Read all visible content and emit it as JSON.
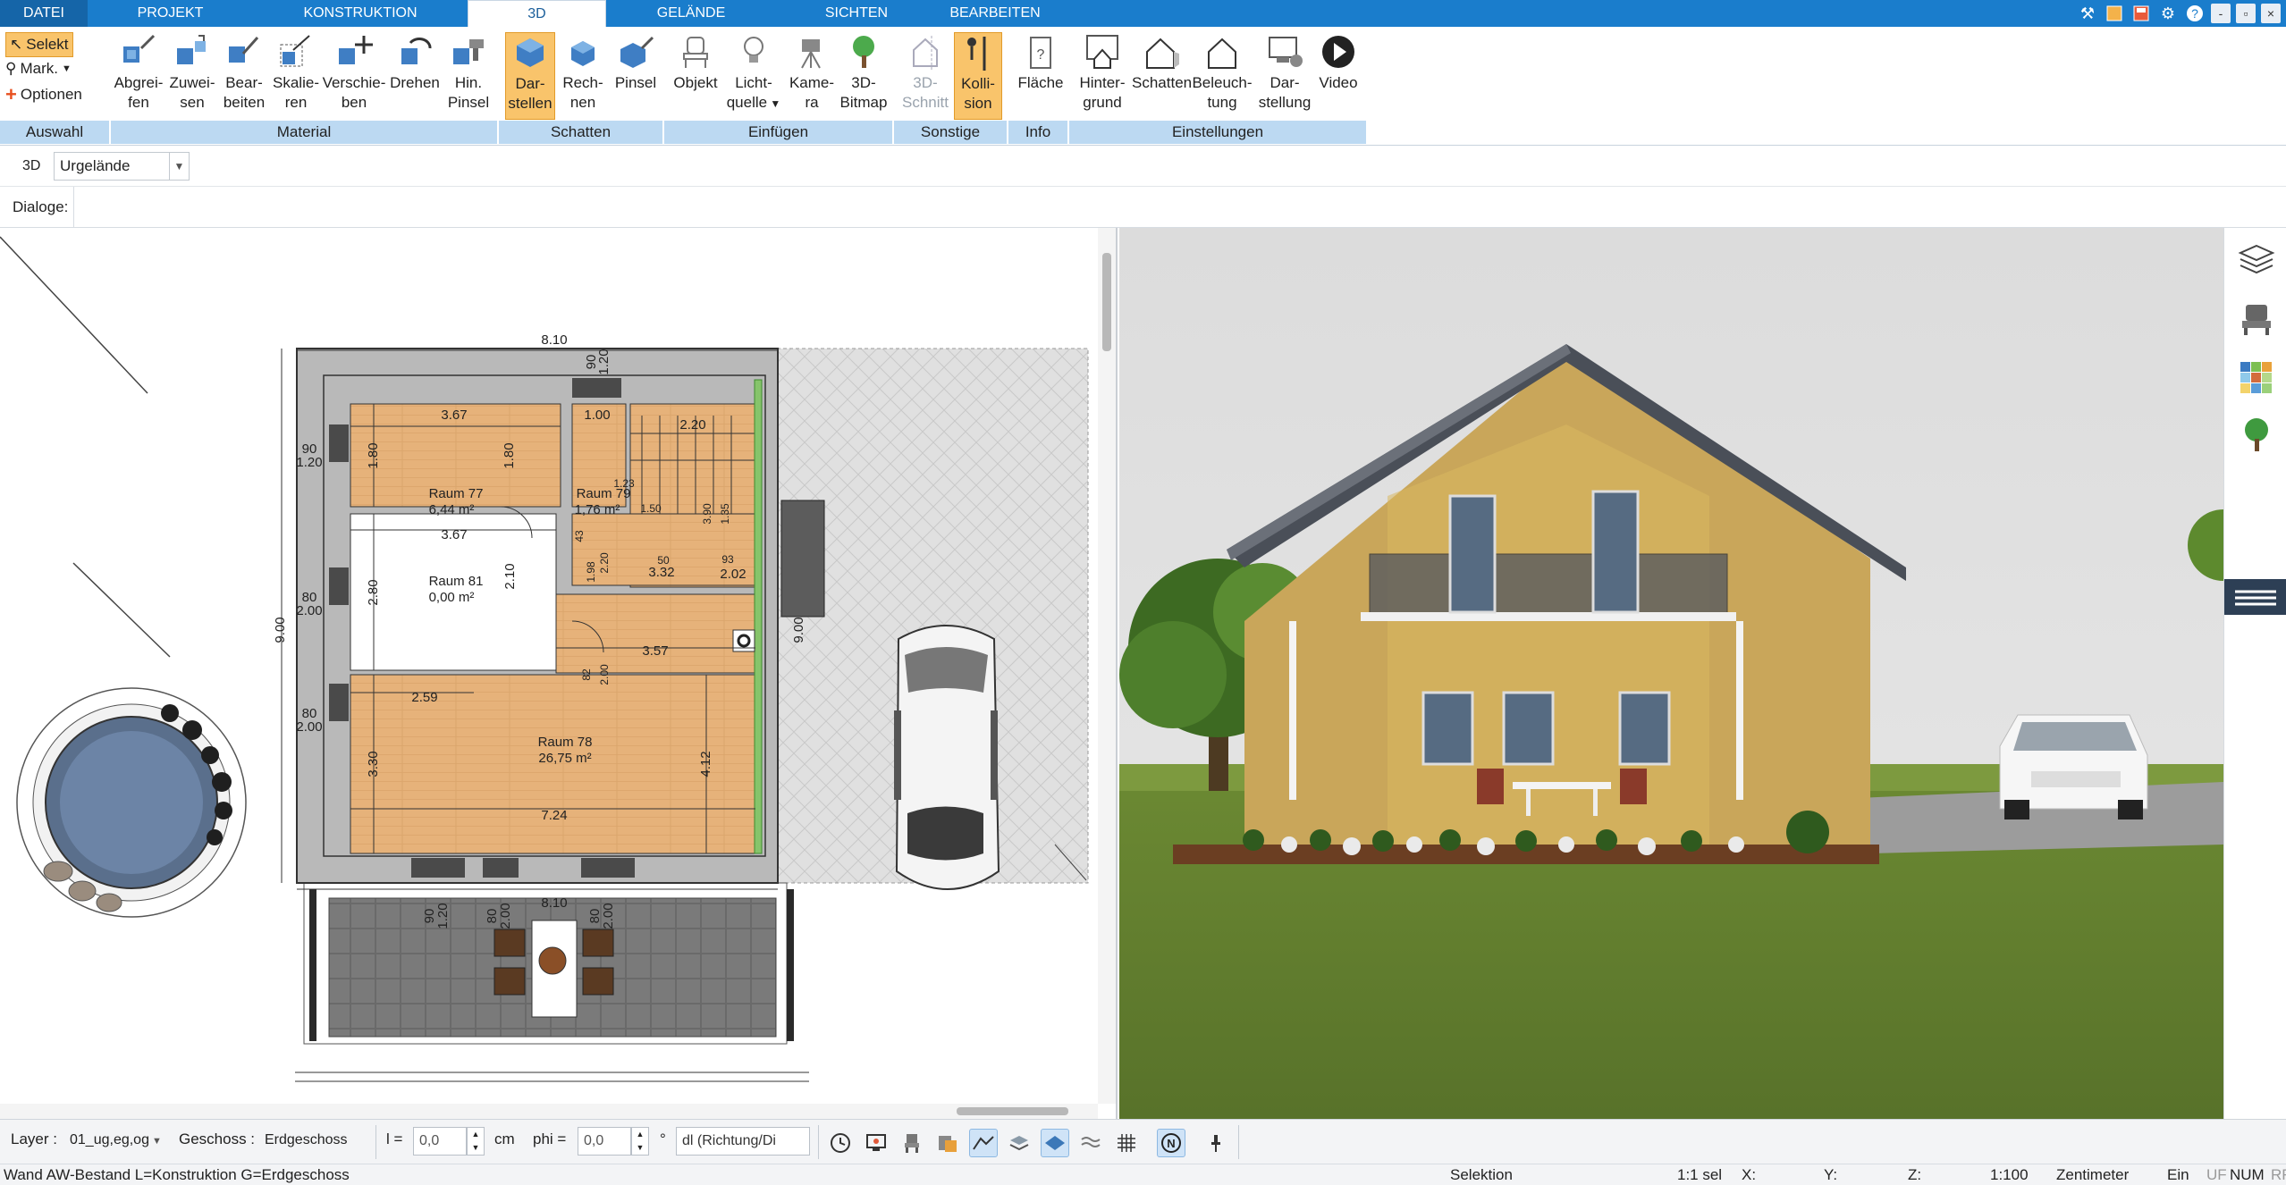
{
  "menu": {
    "tabs": [
      {
        "label": "DATEI"
      },
      {
        "label": "PROJEKT"
      },
      {
        "label": "KONSTRUKTION"
      },
      {
        "label": "3D"
      },
      {
        "label": "GELÄNDE"
      },
      {
        "label": "SICHTEN"
      },
      {
        "label": "BEARBEITEN"
      }
    ],
    "active_tab": "3D",
    "brand_color": "#1a7dcc"
  },
  "window_controls": {
    "minimize": "-",
    "restore": "▫",
    "close": "×"
  },
  "ribbon": {
    "left": {
      "select_label": "Selekt",
      "mark_label": "Mark.",
      "options_label": "Optionen"
    },
    "buttons": {
      "abgreifen": [
        "Abgrei-",
        "fen"
      ],
      "zuweisen": [
        "Zuwei-",
        "sen"
      ],
      "bearbeiten": [
        "Bear-",
        "beiten"
      ],
      "skalieren": [
        "Skalie-",
        "ren"
      ],
      "verschieben": [
        "Verschie-",
        "ben"
      ],
      "drehen": [
        "Drehen"
      ],
      "hinpinsel": [
        "Hin.",
        "Pinsel"
      ],
      "darstellen": [
        "Dar-",
        "stellen"
      ],
      "rechnen": [
        "Rech-",
        "nen"
      ],
      "pinsel": [
        "Pinsel"
      ],
      "objekt": [
        "Objekt"
      ],
      "lichtquelle": [
        "Licht-",
        "quelle"
      ],
      "kamera": [
        "Kame-",
        "ra"
      ],
      "bitmap3d": [
        "3D-",
        "Bitmap"
      ],
      "schnitt3d": [
        "3D-",
        "Schnitt"
      ],
      "kollision": [
        "Kolli-",
        "sion"
      ],
      "flaeche": [
        "Fläche"
      ],
      "hintergrund": [
        "Hinter-",
        "grund"
      ],
      "schatten": [
        "Schatten"
      ],
      "beleuchtung": [
        "Beleuch-",
        "tung"
      ],
      "darstellung": [
        "Dar-",
        "stellung"
      ],
      "video": [
        "Video"
      ]
    },
    "groups": {
      "auswahl": "Auswahl",
      "material": "Material",
      "schatten": "Schatten",
      "einfuegen": "Einfügen",
      "sonstige": "Sonstige",
      "info": "Info",
      "einstellungen": "Einstellungen"
    }
  },
  "row3d": {
    "label": "3D",
    "select_value": "Urgelände"
  },
  "dialoge_label": "Dialoge:",
  "plan": {
    "dims": {
      "top_width": "8.10",
      "top_small1": "90",
      "top_small2": "1.20",
      "r77_w": "3.67",
      "r77_h1": "1.80",
      "r77_h2": "1.80",
      "r77_area_label": "Raum 77",
      "r77_area": "6,44 m²",
      "r79_w": "1.00",
      "r79_label": "Raum 79",
      "r79_area": "1,76 m²",
      "stair_w": "2.20",
      "r81_w": "3.67",
      "r81_h": "2.80",
      "r81_h2": "2.10",
      "r81_label": "Raum 81",
      "r81_area": "0,00 m²",
      "mid_dim": "2.02",
      "mid_dim2": "3.32",
      "hall_w": "3.57",
      "r78_w": "2.59",
      "r78_h": "3.30",
      "r78_h2": "4.12",
      "r78_label": "Raum 78",
      "r78_area": "26,75 m²",
      "r78_bottom": "7.24",
      "left_total": "9.00",
      "right_total": "9.00",
      "left_a1": "90",
      "left_a2": "1.20",
      "left_b1": "80",
      "left_b2": "2.00",
      "left_c1": "80",
      "left_c2": "2.00",
      "bottom_width": "8.10",
      "bottom_a1": "90",
      "bottom_a2": "1.20",
      "bottom_b1": "80",
      "bottom_b2": "2.00",
      "bottom_c1": "80",
      "bottom_c2": "2.00",
      "stair_nums": [
        "1.23",
        "1.50",
        "3.90",
        "1.35",
        "93",
        "1.98",
        "2.20",
        "43",
        "82",
        "2.00",
        "50"
      ]
    }
  },
  "side_icons": [
    "layers-icon",
    "furniture-icon",
    "textures-icon",
    "plants-icon",
    "menu-icon"
  ],
  "statusbar": {
    "layer_label": "Layer :",
    "layer_value": "01_ug,eg,og",
    "geschoss_label": "Geschoss :",
    "geschoss_value": "Erdgeschoss",
    "l_label": "l =",
    "l_value": "0,0",
    "l_unit": "cm",
    "phi_label": "phi =",
    "phi_value": "0,0",
    "phi_unit": "°",
    "dl_value": "dl (Richtung/Di"
  },
  "status2": {
    "message": "Wand AW-Bestand L=Konstruktion G=Erdgeschoss",
    "mode": "Selektion",
    "sel": "1:1 sel",
    "x": "X:",
    "y": "Y:",
    "z": "Z:",
    "scale": "1:100",
    "unit": "Zentimeter",
    "ein": "Ein",
    "uf": "UF",
    "num": "NUM",
    "rf": "RF"
  }
}
